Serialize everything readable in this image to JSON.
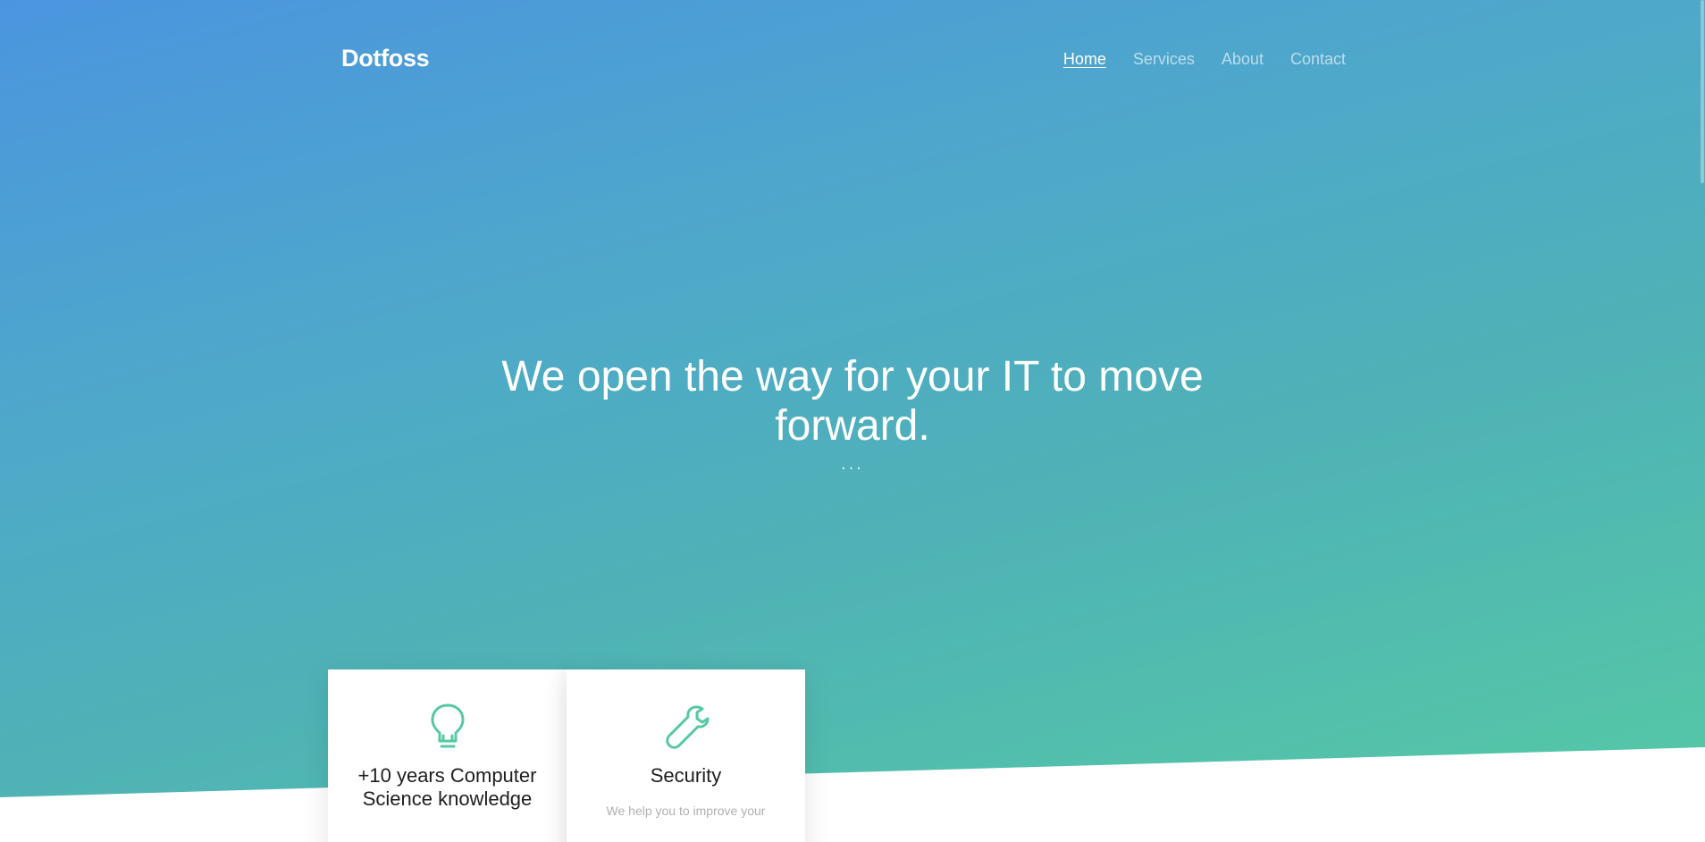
{
  "brand": "Dotfoss",
  "nav": {
    "items": [
      {
        "label": "Home"
      },
      {
        "label": "Services"
      },
      {
        "label": "About"
      },
      {
        "label": "Contact"
      }
    ]
  },
  "hero": {
    "headline": "We open the way for your IT to move forward.",
    "dots": "..."
  },
  "cards": [
    {
      "icon": "lightbulb-icon",
      "title": "+10 years Computer Science knowledge",
      "desc": ""
    },
    {
      "icon": "wrench-icon",
      "title": "Security",
      "desc": "We help you to improve your"
    }
  ],
  "colors": {
    "gradient_start": "#4b95df",
    "gradient_end": "#56cba3",
    "icon_accent": "#56c8a2"
  }
}
